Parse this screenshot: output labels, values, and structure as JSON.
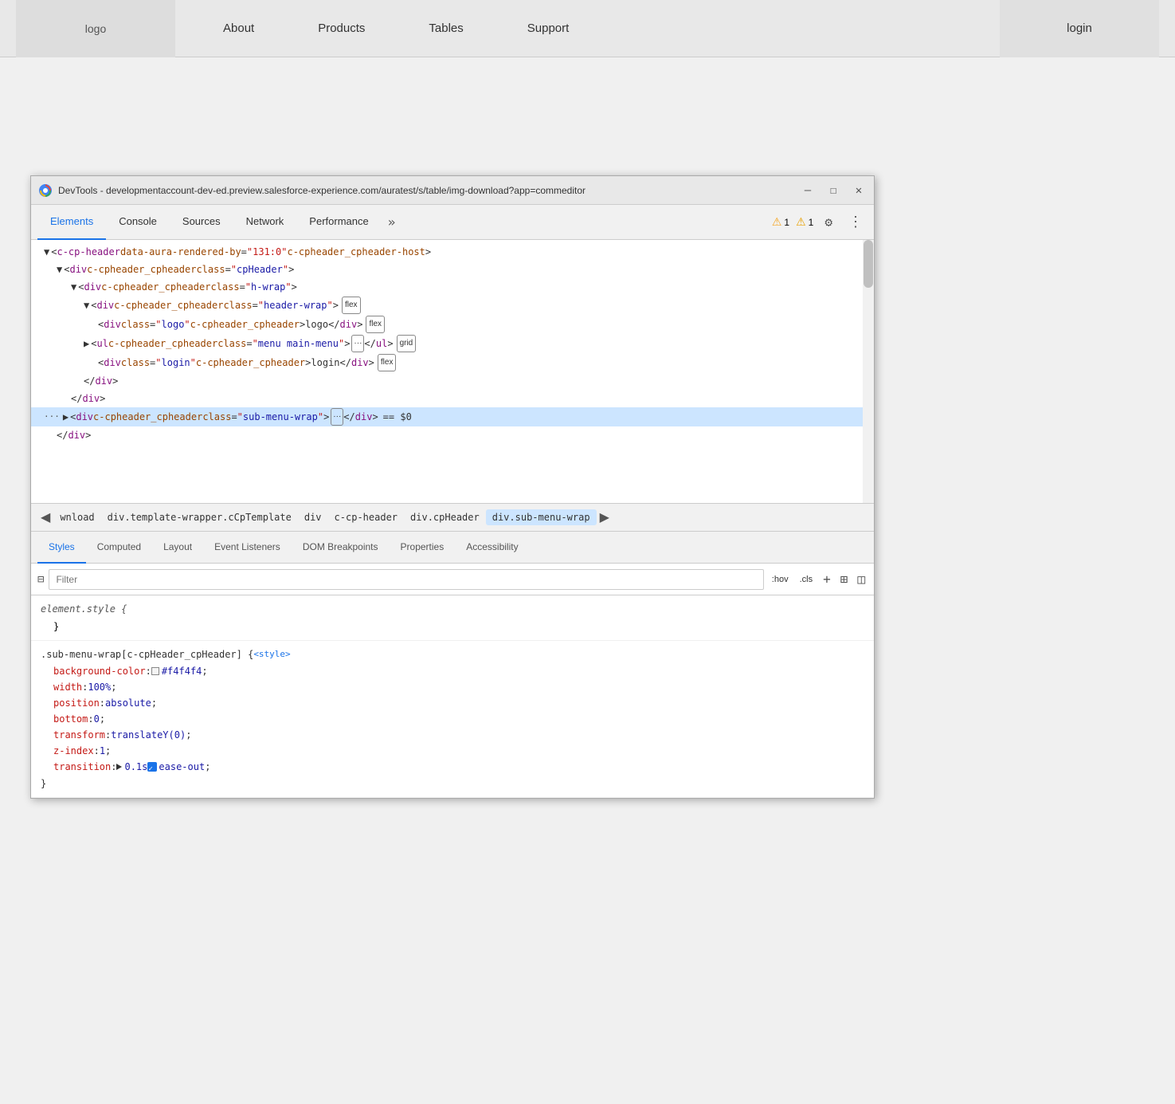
{
  "navbar": {
    "logo": "logo",
    "links": [
      "About",
      "Products",
      "Tables",
      "Support"
    ],
    "login": "login"
  },
  "devtools": {
    "titlebar": {
      "url": "DevTools - developmentaccount-dev-ed.preview.salesforce-experience.com/auratest/s/table/img-download?app=commeditor",
      "controls": [
        "—",
        "☐",
        "✕"
      ]
    },
    "tabs": [
      "Elements",
      "Console",
      "Sources",
      "Network",
      "Performance"
    ],
    "more_label": "»",
    "warn_count": "1",
    "err_count": "1",
    "gear_icon": "⚙",
    "dots_icon": "⋮"
  },
  "html": {
    "lines": [
      {
        "indent": 0,
        "content": "▼ <c-cp-header data-aura-rendered-by=\"131:0\" c-cpheader_cpheader-host>"
      },
      {
        "indent": 1,
        "content": "▼ <div c-cpheader_cpheader class=\"cpHeader\">"
      },
      {
        "indent": 2,
        "content": "▼ <div c-cpheader_cpheader class=\"h-wrap\">"
      },
      {
        "indent": 3,
        "content": "▼ <div c-cpheader_cpheader class=\"header-wrap\"> flex"
      },
      {
        "indent": 4,
        "content": "<div class=\"logo\" c-cpheader_cpheader>logo</div> flex"
      },
      {
        "indent": 3,
        "content": "▶ <ul c-cpheader_cpheader class=\"menu main-menu\"> ··· </ul> grid"
      },
      {
        "indent": 4,
        "content": "<div class=\"login\" c-cpheader_cpheader>login</div> flex"
      },
      {
        "indent": 3,
        "content": "</div>"
      },
      {
        "indent": 2,
        "content": "</div>"
      },
      {
        "indent": 1,
        "content": "··· ▶ <div c-cpheader_cpheader class=\"sub-menu-wrap\"> ··· </div> == $0"
      },
      {
        "indent": 2,
        "content": "</div>"
      }
    ]
  },
  "breadcrumb": {
    "items": [
      "wnload",
      "div.template-wrapper.cCpTemplate",
      "div",
      "c-cp-header",
      "div.cpHeader",
      "div.sub-menu-wrap"
    ]
  },
  "bottom_tabs": {
    "tabs": [
      "Styles",
      "Computed",
      "Layout",
      "Event Listeners",
      "DOM Breakpoints",
      "Properties",
      "Accessibility"
    ]
  },
  "filter": {
    "placeholder": "Filter",
    "hov_label": ":hov",
    "cls_label": ".cls"
  },
  "styles": {
    "element_style": "element.style {",
    "element_style_close": "}",
    "rule1": {
      "selector": ".sub-menu-wrap[c-cpHeader_cpHeader] {",
      "source": "<style>",
      "properties": [
        {
          "prop": "background-color",
          "val": "#f4f4f4",
          "has_swatch": true,
          "swatch_color": "#f4f4f4"
        },
        {
          "prop": "width",
          "val": "100%"
        },
        {
          "prop": "position",
          "val": "absolute"
        },
        {
          "prop": "bottom",
          "val": "0"
        },
        {
          "prop": "transform",
          "val": "translateY(0)"
        },
        {
          "prop": "z-index",
          "val": "1"
        },
        {
          "prop": "transition",
          "val": "▶ 0.1s ☑ ease-out"
        }
      ],
      "close": "}"
    }
  }
}
